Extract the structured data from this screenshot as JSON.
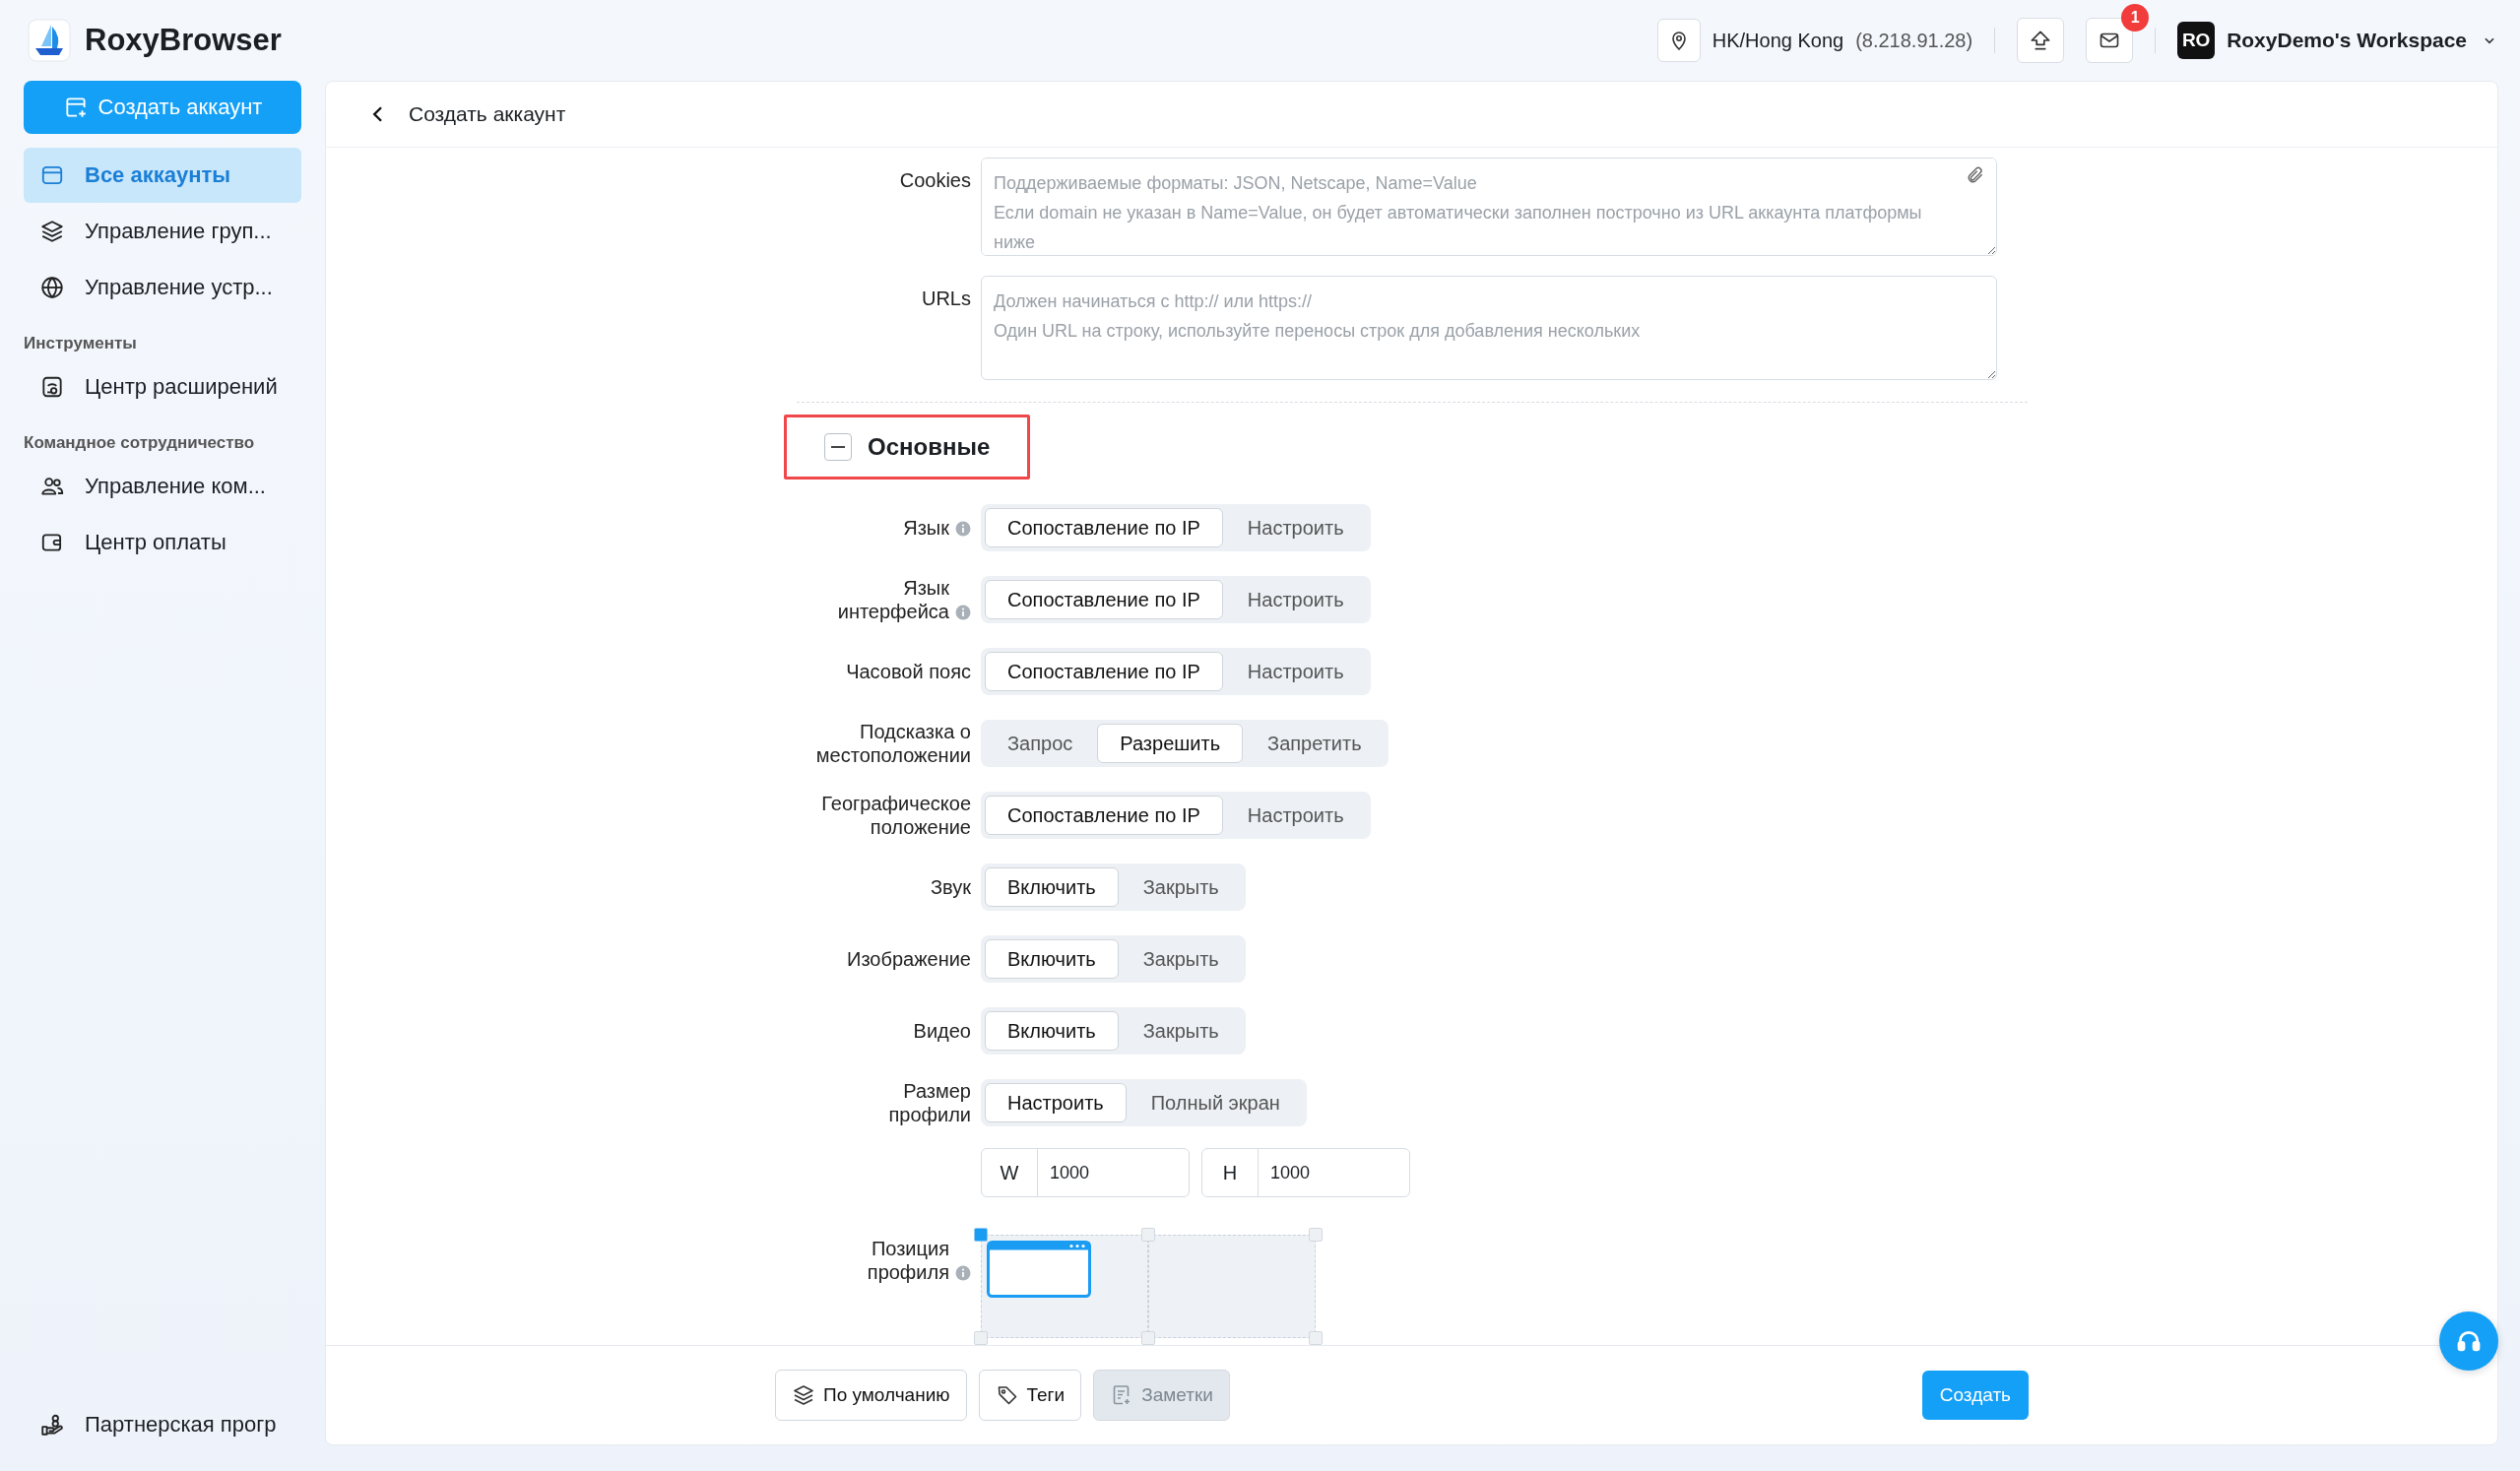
{
  "app": {
    "name": "RoxyBrowser"
  },
  "header": {
    "location": "HK/Hong Kong",
    "ip": "(8.218.91.28)",
    "notifications": "1",
    "workspace_initials": "RO",
    "workspace": "RoxyDemo's Workspace"
  },
  "sidebar": {
    "create_button": "Создать аккаунт",
    "sections": [
      {
        "items": [
          {
            "label": "Все аккаунты",
            "selected": true
          },
          {
            "label": "Управление груп...",
            "selected": false
          },
          {
            "label": "Управление устр...",
            "selected": false
          }
        ]
      },
      {
        "heading": "Инструменты",
        "items": [
          {
            "label": "Центр расширений",
            "selected": false
          }
        ]
      },
      {
        "heading": "Командное сотрудничество",
        "items": [
          {
            "label": "Управление ком...",
            "selected": false
          },
          {
            "label": "Центр оплаты",
            "selected": false
          }
        ]
      }
    ],
    "footer_item": "Партнерская прогр"
  },
  "panel": {
    "title": "Создать аккаунт"
  },
  "form": {
    "cookies": {
      "label": "Cookies",
      "placeholder": "Поддерживаемые форматы: JSON, Netscape, Name=Value\nЕсли domain не указан в Name=Value, он будет автоматически заполнен построчно из URL аккаунта платформы ниже"
    },
    "urls": {
      "label": "URLs",
      "placeholder": "Должен начинаться с http:// или https://\nОдин URL на строку, используйте переносы строк для добавления нескольких"
    },
    "section": {
      "title": "Основные",
      "expanded": true,
      "highlighted": true
    },
    "rows": [
      {
        "kind": "segmented",
        "label": "Язык",
        "info": true,
        "options": [
          {
            "label": "Сопоставление по IP",
            "selected": true
          },
          {
            "label": "Настроить",
            "selected": false
          }
        ]
      },
      {
        "kind": "segmented",
        "label": "Язык\nинтерфейса",
        "info": true,
        "options": [
          {
            "label": "Сопоставление по IP",
            "selected": true
          },
          {
            "label": "Настроить",
            "selected": false
          }
        ]
      },
      {
        "kind": "segmented",
        "label": "Часовой пояс",
        "info": false,
        "options": [
          {
            "label": "Сопоставление по IP",
            "selected": true
          },
          {
            "label": "Настроить",
            "selected": false
          }
        ]
      },
      {
        "kind": "segmented",
        "label": "Подсказка о\nместоположении",
        "info": false,
        "options": [
          {
            "label": "Запрос",
            "selected": false
          },
          {
            "label": "Разрешить",
            "selected": true
          },
          {
            "label": "Запретить",
            "selected": false
          }
        ]
      },
      {
        "kind": "segmented",
        "label": "Географическое\nположение",
        "info": false,
        "options": [
          {
            "label": "Сопоставление по IP",
            "selected": true
          },
          {
            "label": "Настроить",
            "selected": false
          }
        ]
      },
      {
        "kind": "segmented",
        "label": "Звук",
        "info": false,
        "options": [
          {
            "label": "Включить",
            "selected": true
          },
          {
            "label": "Закрыть",
            "selected": false
          }
        ]
      },
      {
        "kind": "segmented",
        "label": "Изображение",
        "info": false,
        "options": [
          {
            "label": "Включить",
            "selected": true
          },
          {
            "label": "Закрыть",
            "selected": false
          }
        ]
      },
      {
        "kind": "segmented",
        "label": "Видео",
        "info": false,
        "options": [
          {
            "label": "Включить",
            "selected": true
          },
          {
            "label": "Закрыть",
            "selected": false
          }
        ]
      },
      {
        "kind": "segmented",
        "label": "Размер\nпрофили",
        "info": false,
        "options": [
          {
            "label": "Настроить",
            "selected": true
          },
          {
            "label": "Полный экран",
            "selected": false
          }
        ]
      },
      {
        "kind": "size_inputs",
        "fields": [
          {
            "prefix": "W",
            "value": "1000"
          },
          {
            "prefix": "H",
            "value": "1000"
          }
        ]
      },
      {
        "kind": "position",
        "label": "Позиция\nпрофиля",
        "info": true,
        "handles": [
          {
            "selected": true
          },
          {
            "selected": false
          },
          {
            "selected": false
          },
          {
            "selected": false
          },
          {
            "selected": false
          },
          {
            "selected": false
          }
        ]
      }
    ]
  },
  "footer": {
    "buttons": [
      {
        "kind": "default",
        "label": "По умолчанию",
        "disabled": false
      },
      {
        "kind": "tags",
        "label": "Теги",
        "disabled": false
      },
      {
        "kind": "notes",
        "label": "Заметки",
        "disabled": true
      }
    ],
    "submit": "Создать"
  }
}
